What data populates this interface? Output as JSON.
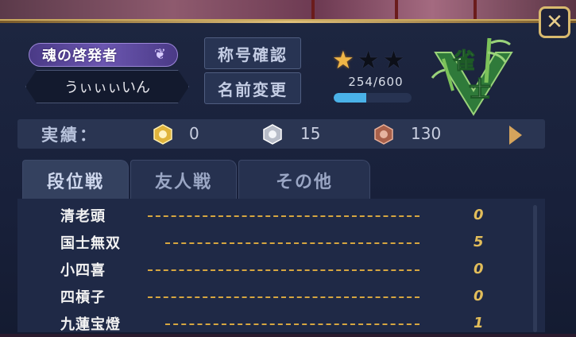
{
  "title_badge": "魂の啓発者",
  "player_name": "うぃぃぃいん",
  "buttons": {
    "confirm_title": "称号確認",
    "change_name": "名前変更"
  },
  "rank": {
    "stars_filled": 1,
    "stars_total": 3,
    "points_text": "254/600",
    "progress": 0.42,
    "label_top": "雀",
    "label_bottom": "士"
  },
  "achievements": {
    "label": "実績：",
    "gold": "0",
    "silver": "15",
    "bronze": "130"
  },
  "tabs": [
    "段位戦",
    "友人戦",
    "その他"
  ],
  "yakuman_list": [
    {
      "name": "清老頭",
      "count": "0"
    },
    {
      "name": "国士無双",
      "count": "5"
    },
    {
      "name": "小四喜",
      "count": "0"
    },
    {
      "name": "四槓子",
      "count": "0"
    },
    {
      "name": "九蓮宝燈",
      "count": "1"
    }
  ],
  "colors": {
    "accent_gold": "#d9b96e",
    "progress_blue": "#4ab2e8",
    "rank_green": "#3aa34a"
  },
  "icons": [
    "close-icon",
    "wing-icon",
    "star-icon",
    "bamboo-rank-emblem",
    "gold-medal-icon",
    "silver-medal-icon",
    "bronze-medal-icon",
    "next-arrow-icon"
  ]
}
